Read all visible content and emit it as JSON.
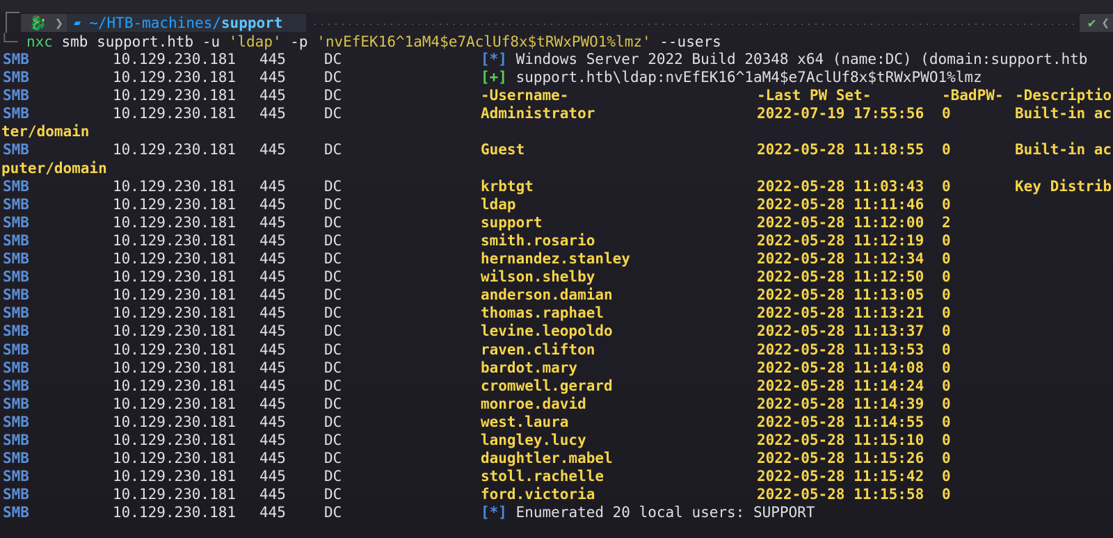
{
  "prompt": {
    "path_prefix": "~/HTB-machines/",
    "path_current": "support",
    "status_check": "✔"
  },
  "command": {
    "prefix": "└─ ",
    "tool": "nxc",
    "args_1": " smb support.htb -u ",
    "user": "'ldap'",
    "args_2": " -p ",
    "password": "'nvEfEK16^1aM4$e7AclUf8x$tRWxPWO1%lmz'",
    "args_3": " --users"
  },
  "conn": {
    "proto": "SMB",
    "ip": "10.129.230.181",
    "port": "445",
    "host": "DC"
  },
  "banner": {
    "tag": "[*]",
    "text": "Windows Server 2022 Build 20348 x64 (name:DC) (domain:support.htb"
  },
  "auth": {
    "tag": "[+]",
    "text": "support.htb\\ldap:nvEfEK16^1aM4$e7AclUf8x$tRWxPWO1%lmz"
  },
  "headers": {
    "username": "-Username-",
    "pwset": "-Last PW Set-",
    "badpw": "-BadPW-",
    "desc": "-Descriptio"
  },
  "users": [
    {
      "name": "Administrator",
      "pwset": "2022-07-19 17:55:56",
      "bad": "0",
      "desc": "Built-in ac",
      "wrap": "ter/domain"
    },
    {
      "name": "Guest",
      "pwset": "2022-05-28 11:18:55",
      "bad": "0",
      "desc": "Built-in ac",
      "wrap": "puter/domain"
    },
    {
      "name": "krbtgt",
      "pwset": "2022-05-28 11:03:43",
      "bad": "0",
      "desc": "Key Distrib"
    },
    {
      "name": "ldap",
      "pwset": "2022-05-28 11:11:46",
      "bad": "0"
    },
    {
      "name": "support",
      "pwset": "2022-05-28 11:12:00",
      "bad": "2"
    },
    {
      "name": "smith.rosario",
      "pwset": "2022-05-28 11:12:19",
      "bad": "0"
    },
    {
      "name": "hernandez.stanley",
      "pwset": "2022-05-28 11:12:34",
      "bad": "0"
    },
    {
      "name": "wilson.shelby",
      "pwset": "2022-05-28 11:12:50",
      "bad": "0"
    },
    {
      "name": "anderson.damian",
      "pwset": "2022-05-28 11:13:05",
      "bad": "0"
    },
    {
      "name": "thomas.raphael",
      "pwset": "2022-05-28 11:13:21",
      "bad": "0"
    },
    {
      "name": "levine.leopoldo",
      "pwset": "2022-05-28 11:13:37",
      "bad": "0"
    },
    {
      "name": "raven.clifton",
      "pwset": "2022-05-28 11:13:53",
      "bad": "0"
    },
    {
      "name": "bardot.mary",
      "pwset": "2022-05-28 11:14:08",
      "bad": "0"
    },
    {
      "name": "cromwell.gerard",
      "pwset": "2022-05-28 11:14:24",
      "bad": "0"
    },
    {
      "name": "monroe.david",
      "pwset": "2022-05-28 11:14:39",
      "bad": "0"
    },
    {
      "name": "west.laura",
      "pwset": "2022-05-28 11:14:55",
      "bad": "0"
    },
    {
      "name": "langley.lucy",
      "pwset": "2022-05-28 11:15:10",
      "bad": "0"
    },
    {
      "name": "daughtler.mabel",
      "pwset": "2022-05-28 11:15:26",
      "bad": "0"
    },
    {
      "name": "stoll.rachelle",
      "pwset": "2022-05-28 11:15:42",
      "bad": "0"
    },
    {
      "name": "ford.victoria",
      "pwset": "2022-05-28 11:15:58",
      "bad": "0"
    }
  ],
  "footer": {
    "tag": "[*]",
    "text": "Enumerated 20 local users: SUPPORT"
  },
  "icons": {
    "kali": "kali-dragon-icon",
    "folder": "folder-icon",
    "check": "check-icon"
  },
  "colors": {
    "background": "#1d1b22",
    "proto": "#5a8ed8",
    "highlight": "#f5d54a",
    "info_tag": "#4a8bdb",
    "success_tag": "#55cf55",
    "path": "#23a0ff",
    "cmd_tool": "#50d070",
    "cmd_string": "#d9c44a"
  }
}
